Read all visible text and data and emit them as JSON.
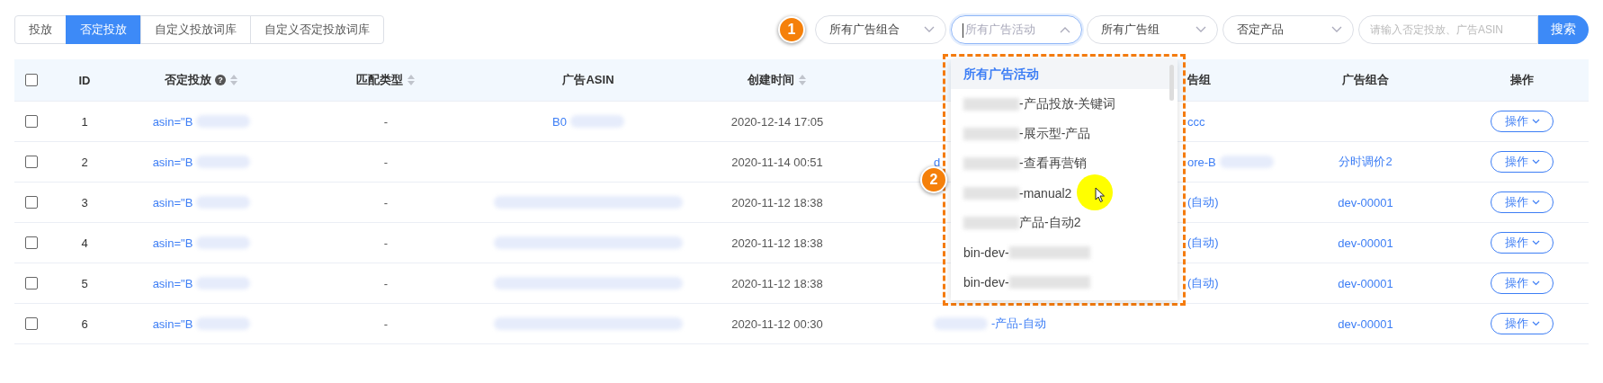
{
  "tabs": [
    {
      "label": "投放",
      "selected": false
    },
    {
      "label": "否定投放",
      "selected": true
    },
    {
      "label": "自定义投放词库",
      "selected": false
    },
    {
      "label": "自定义否定投放词库",
      "selected": false
    }
  ],
  "filters": {
    "step_marker": "1",
    "selects": [
      {
        "label": "所有广告组合",
        "open": false,
        "kind": "value"
      },
      {
        "label": "所有广告活动",
        "open": true,
        "kind": "placeholder"
      },
      {
        "label": "所有广告组",
        "open": false,
        "kind": "value"
      },
      {
        "label": "否定产品",
        "open": false,
        "kind": "value"
      }
    ],
    "search": {
      "placeholder": "请输入否定投放、广告ASIN"
    },
    "search_button": "搜索"
  },
  "dropdown": {
    "step_marker": "2",
    "items": [
      {
        "text": "所有广告活动",
        "selected": true,
        "hovered": false
      },
      {
        "text": "-产品投放-关键词",
        "selected": false,
        "hovered": false,
        "blur_before": true
      },
      {
        "text": "-展示型-产品",
        "selected": false,
        "hovered": false,
        "blur_before": true
      },
      {
        "text": "-查看再营销",
        "selected": false,
        "hovered": false,
        "blur_before": true
      },
      {
        "text": "-manual2",
        "selected": false,
        "hovered": true,
        "blur_before": true
      },
      {
        "text": "产品-自动2",
        "selected": false,
        "hovered": false,
        "blur_before": true
      },
      {
        "text": "bin-dev-",
        "selected": false,
        "hovered": false,
        "blur_after": true
      },
      {
        "text": "bin-dev-",
        "selected": false,
        "hovered": false,
        "blur_after": true
      }
    ]
  },
  "table": {
    "select_all": {
      "checked": false
    },
    "columns": [
      {
        "label": "ID",
        "kind": "id"
      },
      {
        "label": "否定投放",
        "kind": "link",
        "help": "?",
        "sortable": true
      },
      {
        "label": "匹配类型",
        "kind": "text",
        "sortable": true
      },
      {
        "label": "广告ASIN",
        "kind": "link"
      },
      {
        "label": "创建时间",
        "kind": "text",
        "sortable": true
      },
      {
        "kind": "link"
      },
      {
        "label": "告组",
        "kind": "link"
      },
      {
        "label": "广告组合",
        "kind": "link"
      },
      {
        "label": "操作",
        "kind": "action"
      }
    ],
    "rows": [
      {
        "checked": false,
        "cells": [
          {
            "text": "1"
          },
          {
            "text": "asin=\"B",
            "blur_after": true
          },
          {
            "text": "-"
          },
          {
            "text": "B0",
            "blur_after": true
          },
          {
            "text": "2020-12-14 17:05"
          },
          "",
          {
            "text": "ccc"
          },
          "",
          {
            "text": "操作"
          }
        ]
      },
      {
        "checked": false,
        "cells": [
          {
            "text": "2"
          },
          {
            "text": "asin=\"B",
            "blur_after": true
          },
          {
            "text": "-"
          },
          "",
          {
            "text": "2020-11-14 00:51"
          },
          {
            "text": "d"
          },
          {
            "text": "ore-B",
            "blur_after": true
          },
          {
            "text": "分时调价2"
          },
          {
            "text": "操作"
          }
        ]
      },
      {
        "checked": false,
        "cells": [
          {
            "text": "3"
          },
          {
            "text": "asin=\"B",
            "blur_after": true
          },
          {
            "text": "-"
          },
          {
            "blur_after": true
          },
          {
            "text": "2020-11-12 18:38"
          },
          "",
          {
            "text": "(自动)"
          },
          {
            "text": "dev-00001"
          },
          {
            "text": "操作"
          }
        ]
      },
      {
        "checked": false,
        "cells": [
          {
            "text": "4"
          },
          {
            "text": "asin=\"B",
            "blur_after": true
          },
          {
            "text": "-"
          },
          {
            "blur_after": true
          },
          {
            "text": "2020-11-12 18:38"
          },
          "",
          {
            "text": "(自动)"
          },
          {
            "text": "dev-00001"
          },
          {
            "text": "操作"
          }
        ]
      },
      {
        "checked": false,
        "cells": [
          {
            "text": "5"
          },
          {
            "text": "asin=\"B",
            "blur_after": true
          },
          {
            "text": "-"
          },
          {
            "blur_after": true
          },
          {
            "text": "2020-11-12 18:38"
          },
          "",
          {
            "text": "(自动)"
          },
          {
            "text": "dev-00001"
          },
          {
            "text": "操作"
          }
        ]
      },
      {
        "checked": false,
        "cells": [
          {
            "text": "6"
          },
          {
            "text": "asin=\"B",
            "blur_after": true
          },
          {
            "text": "-"
          },
          {
            "blur_after": true
          },
          {
            "text": "2020-11-12 00:30"
          },
          {
            "text": "-产品-自动",
            "blur_before": true
          },
          "",
          {
            "text": "dev-00001"
          },
          {
            "text": "操作"
          }
        ]
      }
    ]
  }
}
